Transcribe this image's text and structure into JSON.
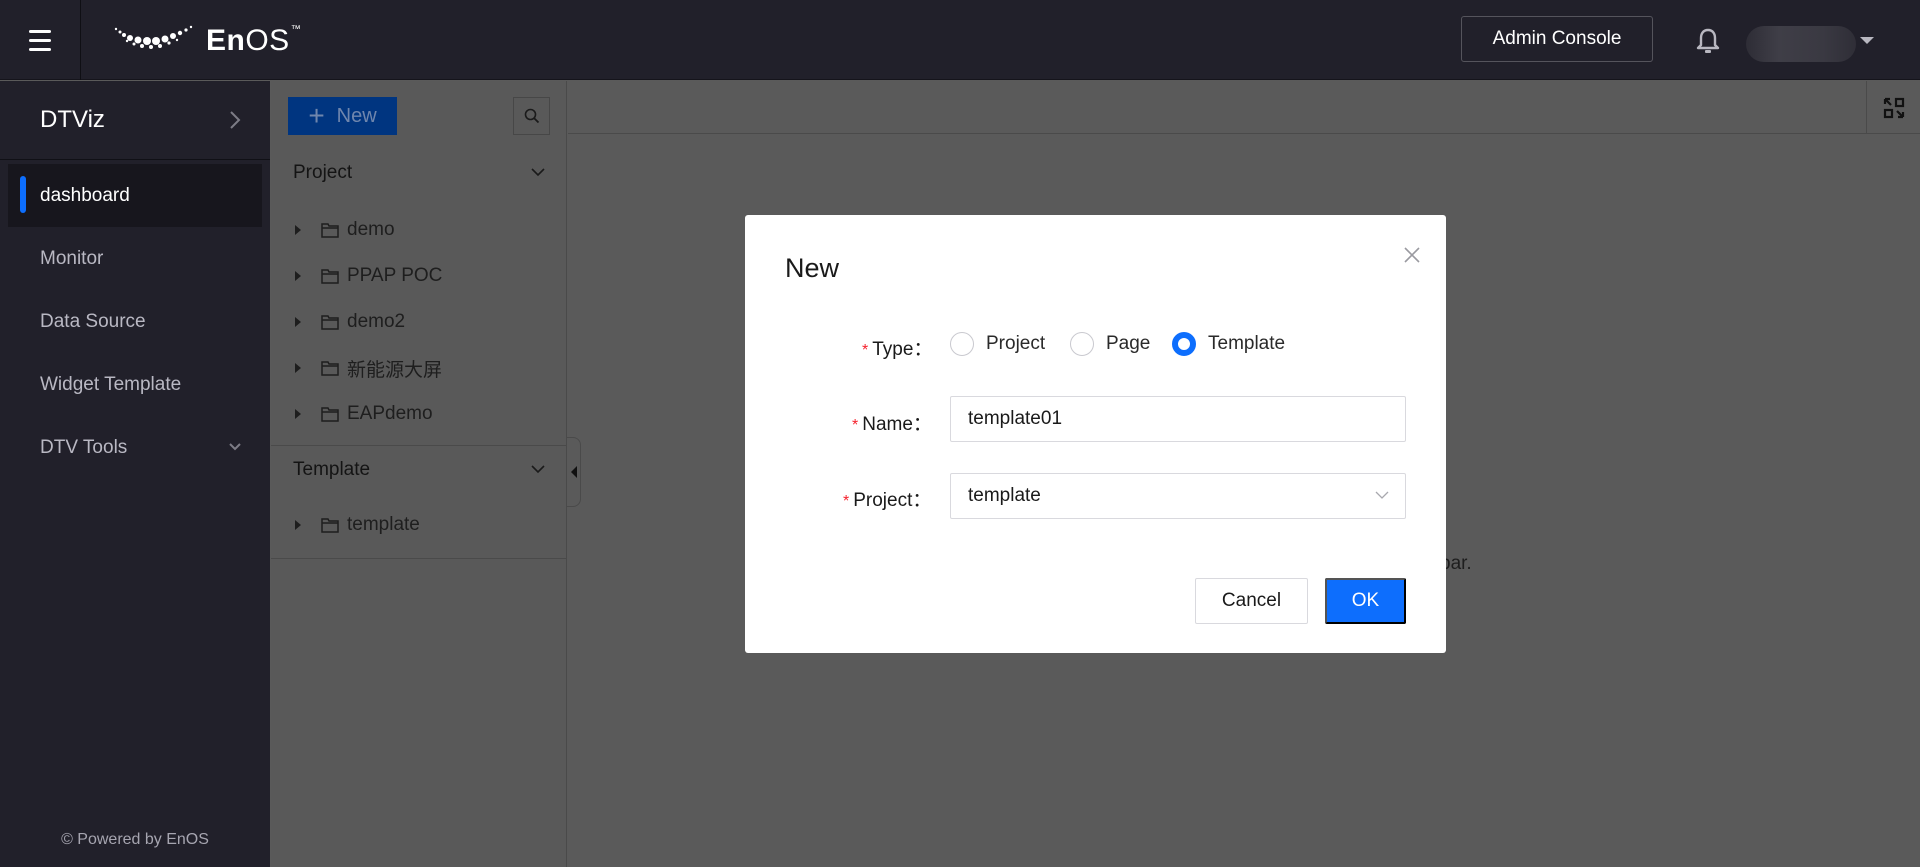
{
  "topbar": {
    "brand": "EnOS",
    "brand_bold": "En",
    "brand_light": "OS",
    "trademark": "™",
    "admin_console_label": "Admin Console",
    "icons": {
      "menu": "hamburger-icon",
      "notifications": "bell-icon",
      "user_menu": "caret-down-icon"
    }
  },
  "sidebar": {
    "app_title": "DTViz",
    "items": [
      {
        "label": "dashboard",
        "active": true
      },
      {
        "label": "Monitor",
        "active": false
      },
      {
        "label": "Data Source",
        "active": false
      },
      {
        "label": "Widget Template",
        "active": false
      },
      {
        "label": "DTV Tools",
        "active": false,
        "expandable": true
      }
    ],
    "footer": "© Powered by EnOS"
  },
  "tree": {
    "new_label": "New",
    "sections": [
      {
        "title": "Project",
        "items": [
          "demo",
          "PPAP POC",
          "demo2",
          "新能源大屏",
          "EAPdemo"
        ]
      },
      {
        "title": "Template",
        "items": [
          "template"
        ]
      }
    ]
  },
  "main": {
    "hint_text_visible": "bar."
  },
  "modal": {
    "title": "New",
    "type_label": "Type",
    "type_options": [
      "Project",
      "Page",
      "Template"
    ],
    "type_selected": "Template",
    "name_label": "Name",
    "name_value": "template01",
    "project_label": "Project",
    "project_value": "template",
    "label_suffix": "：",
    "required_mark": "*",
    "cancel_label": "Cancel",
    "ok_label": "OK"
  },
  "colors": {
    "accent": "#0d6efd",
    "topbar_bg": "#21202a",
    "overlay": "#5a5a5a",
    "required": "#f5222d"
  }
}
